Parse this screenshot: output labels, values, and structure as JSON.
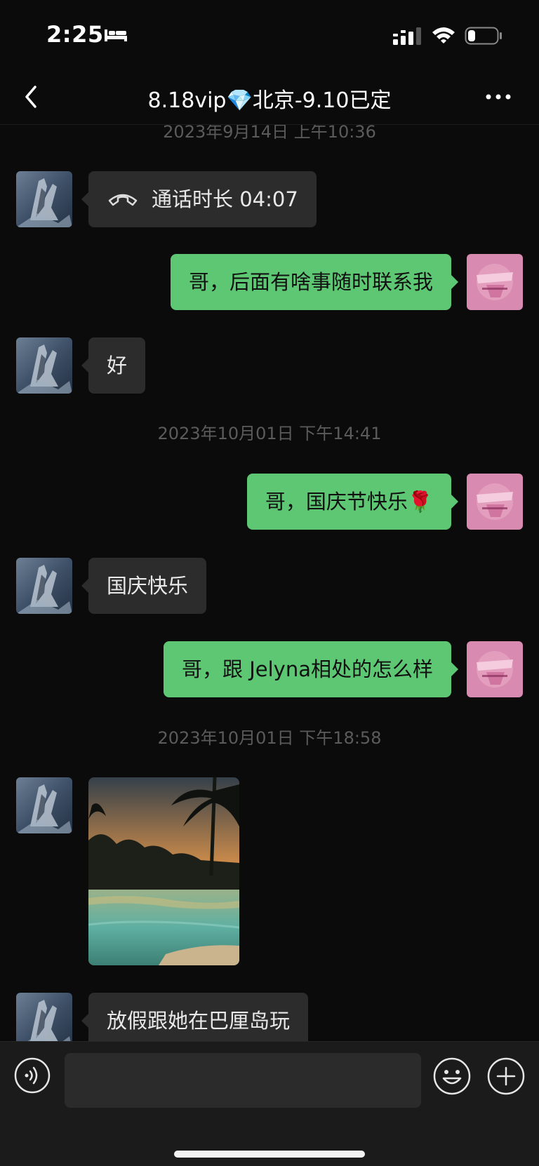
{
  "status_bar": {
    "time": "2:25",
    "icons": [
      "bed-icon",
      "cellular-signal-icon",
      "wifi-icon",
      "battery-icon"
    ],
    "battery_level": 0.25
  },
  "nav": {
    "back_icon": "chevron-left-icon",
    "title": "8.18vip💎北京-9.10已定",
    "more_icon": "more-dots-icon"
  },
  "messages": {
    "ts0": "2023年9月14日 上午10:36",
    "call": {
      "label": "通话时长 04:07",
      "icon": "phone-hangup-icon"
    },
    "m1": "哥，后面有啥事随时联系我",
    "m2": "好",
    "ts1": "2023年10月01日 下午14:41",
    "m3": "哥，国庆节快乐🌹",
    "m4": "国庆快乐",
    "m5": "哥，跟 Jelyna相处的怎么样",
    "ts2": "2023年10月01日 下午18:58",
    "photo": {
      "icon": "sunset-pool-photo"
    },
    "m6": "放假跟她在巴厘岛玩"
  },
  "avatars": {
    "contact": "praying-hands-avatar",
    "self": "pink-logo-avatar"
  },
  "input_bar": {
    "voice_icon": "voice-mode-icon",
    "input_value": "",
    "emoji_icon": "emoji-icon",
    "plus_icon": "plus-icon"
  },
  "colors": {
    "background": "#0b0b0b",
    "incoming_bubble": "#2c2c2c",
    "outgoing_bubble": "#5ec773",
    "timestamp": "#5b5b5b",
    "input_bar": "#1b1b1b"
  }
}
